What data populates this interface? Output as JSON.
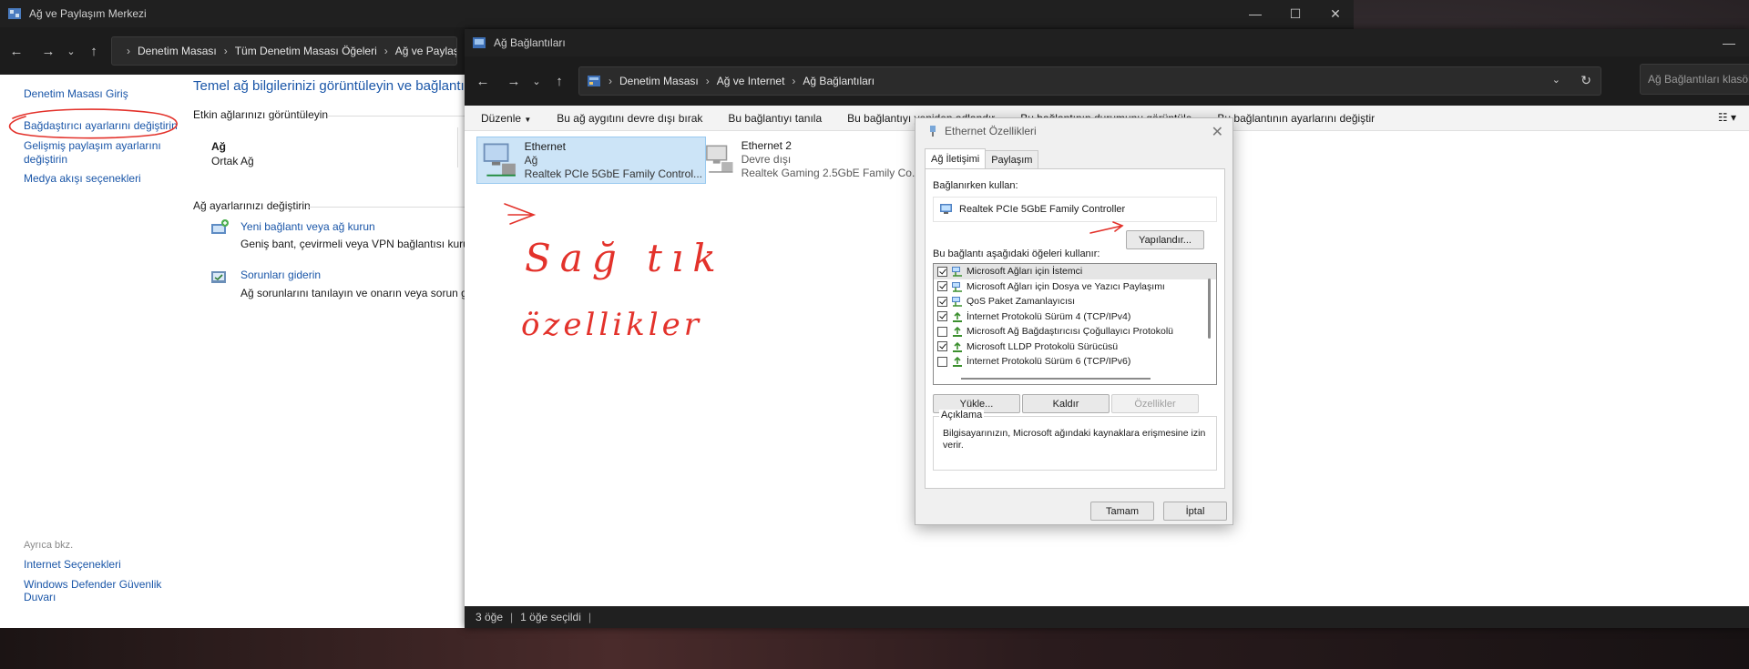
{
  "nsc_window": {
    "title": "Ağ ve Paylaşım Merkezi",
    "breadcrumb": [
      "Denetim Masası",
      "Tüm Denetim Masası Öğeleri",
      "Ağ ve Paylaşım"
    ],
    "sidebar": {
      "home": "Denetim Masası Giriş",
      "change_adapter": "Bağdaştırıcı ayarlarını değiştirin",
      "advanced_sharing_1": "Gelişmiş paylaşım ayarlarını",
      "advanced_sharing_2": "değiştirin",
      "media_streaming": "Medya akışı seçenekleri",
      "see_also": "Ayrıca bkz.",
      "internet_options": "Internet Seçenekleri",
      "defender_1": "Windows Defender Güvenlik",
      "defender_2": "Duvarı"
    },
    "main_title": "Temel ağ bilgilerinizi görüntüleyin ve bağlantıları",
    "active_networks_heading": "Etkin ağlarınızı görüntüleyin",
    "network_name": "Ağ",
    "network_type": "Ortak Ağ",
    "change_settings_heading": "Ağ ayarlarınızı değiştirin",
    "new_connection_link": "Yeni bağlantı veya ağ kurun",
    "new_connection_desc": "Geniş bant, çevirmeli veya VPN bağlantısı kurun",
    "troubleshoot_link": "Sorunları giderin",
    "troubleshoot_desc": "Ağ sorunlarını tanılayın ve onarın veya sorun gid"
  },
  "nc_window": {
    "title": "Ağ Bağlantıları",
    "breadcrumb": [
      "Denetim Masası",
      "Ağ ve Internet",
      "Ağ Bağlantıları"
    ],
    "search_placeholder": "Ağ Bağlantıları klasörün",
    "commands": [
      "Düzenle",
      "Bu ağ aygıtını devre dışı bırak",
      "Bu bağlantıyı tanıla",
      "Bu bağlantıyı yeniden adlandır",
      "Bu bağlantının durumunu görüntüle",
      "Bu bağlantının ayarlarını değiştir"
    ],
    "connections": [
      {
        "name": "Ethernet",
        "status": "Ağ",
        "device": "Realtek PCIe 5GbE Family Control..."
      },
      {
        "name": "Ethernet 2",
        "status": "Devre dışı",
        "device": "Realtek Gaming 2.5GbE Family Co..."
      }
    ],
    "status_count": "3 öğe",
    "status_selected": "1 öğe seçildi"
  },
  "dialog": {
    "title": "Ethernet Özellikleri",
    "tabs": [
      "Ağ İletişimi",
      "Paylaşım"
    ],
    "connect_using_label": "Bağlanırken kullan:",
    "adapter_name": "Realtek PCIe 5GbE Family Controller",
    "configure_button": "Yapılandır...",
    "items_label": "Bu bağlantı aşağıdaki öğeleri kullanır:",
    "items": [
      {
        "label": "Microsoft Ağları için İstemci",
        "checked": true,
        "icon": "network-client-icon"
      },
      {
        "label": "Microsoft Ağları için Dosya ve Yazıcı Paylaşımı",
        "checked": true,
        "icon": "network-service-icon"
      },
      {
        "label": "QoS Paket Zamanlayıcısı",
        "checked": true,
        "icon": "network-service-icon"
      },
      {
        "label": "İnternet Protokolü Sürüm 4 (TCP/IPv4)",
        "checked": true,
        "icon": "protocol-icon"
      },
      {
        "label": "Microsoft Ağ Bağdaştırıcısı Çoğullayıcı Protokolü",
        "checked": false,
        "icon": "protocol-icon"
      },
      {
        "label": "Microsoft LLDP Protokolü Sürücüsü",
        "checked": true,
        "icon": "protocol-icon"
      },
      {
        "label": "İnternet Protokolü Sürüm 6 (TCP/IPv6)",
        "checked": false,
        "icon": "protocol-icon"
      }
    ],
    "install_button": "Yükle...",
    "uninstall_button": "Kaldır",
    "properties_button": "Özellikler",
    "description_legend": "Açıklama",
    "description_text": "Bilgisayarınızın, Microsoft ağındaki kaynaklara erişmesine izin verir.",
    "ok_button": "Tamam",
    "cancel_button": "İptal"
  },
  "annotations": {
    "right_click": "Sağ tık",
    "properties": "özellikler"
  },
  "colors": {
    "link": "#1a56a8",
    "annotation": "#e3322b",
    "titlebar": "#202020"
  }
}
